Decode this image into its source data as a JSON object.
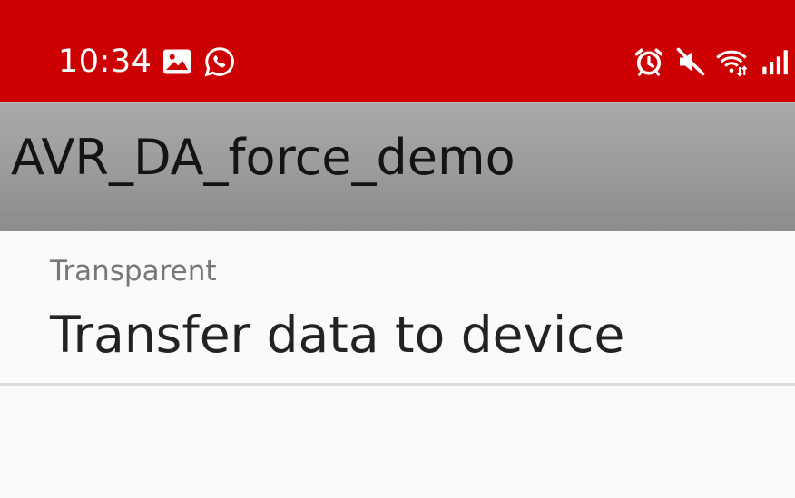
{
  "status_bar": {
    "time": "10:34",
    "left_icons": [
      "image-icon",
      "whatsapp-icon"
    ],
    "right_icons": [
      "alarm-icon",
      "mute-icon",
      "wifi-icon",
      "signal-icon"
    ],
    "background": "#cc0000"
  },
  "app_bar": {
    "title": "AVR_DA_force_demo"
  },
  "list": {
    "items": [
      {
        "overline": "Transparent",
        "title": "Transfer data to device"
      }
    ]
  }
}
